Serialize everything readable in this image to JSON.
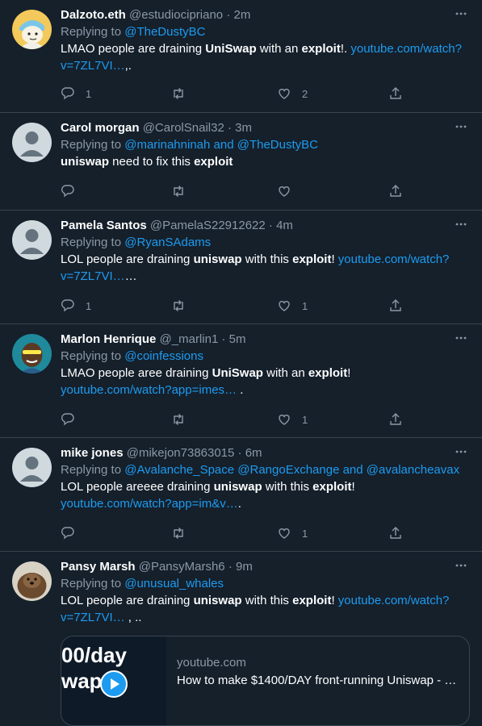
{
  "tweets": [
    {
      "name": "Dalzoto.eth",
      "handle": "@estudiocipriano",
      "time": "· 2m",
      "replying_prefix": "Replying to ",
      "replying_to": "@TheDustyBC",
      "replying_and": "",
      "replying_to_2": "",
      "body": {
        "p1": "LMAO people are draining ",
        "b1": "UniSwap",
        "p2": " with an ",
        "b2": "exploit",
        "p3": "!. ",
        "link": "youtube.com/watch?v=7ZL7VI…",
        "p4": ",."
      },
      "reply_count": "1",
      "retweet_count": "",
      "like_count": "2",
      "avatar": "cartoon-avatar"
    },
    {
      "name": "Carol morgan",
      "handle": "@CarolSnail32",
      "time": "· 3m",
      "replying_prefix": "Replying to ",
      "replying_to": "@marinahninah",
      "replying_and": " and ",
      "replying_to_2": "@TheDustyBC",
      "body": {
        "b1": "uniswap",
        "p2": " need to fix this ",
        "b2": "exploit"
      },
      "reply_count": "",
      "retweet_count": "",
      "like_count": "",
      "avatar": "default-avatar"
    },
    {
      "name": "Pamela Santos",
      "handle": "@PamelaS22912622",
      "time": "· 4m",
      "replying_prefix": "Replying to ",
      "replying_to": "@RyanSAdams",
      "body": {
        "p1": "LOL people are draining ",
        "b1": "uniswap",
        "p2": " with this ",
        "b2": "exploit",
        "p3": "! ",
        "link": "youtube.com/watch?v=7ZL7VI…",
        "p4": "…"
      },
      "reply_count": "1",
      "retweet_count": "",
      "like_count": "1",
      "avatar": "default-avatar"
    },
    {
      "name": "Marlon Henrique",
      "handle": "@_marlin1",
      "time": "· 5m",
      "replying_prefix": "Replying to ",
      "replying_to": "@coinfessions",
      "body": {
        "p1": "LMAO people aree draining ",
        "b1": "UniSwap",
        "p2": " with an ",
        "b2": "exploit",
        "p3": "!",
        "link": "youtube.com/watch?app=imes…",
        "p4": " ."
      },
      "reply_count": "",
      "retweet_count": "",
      "like_count": "1",
      "avatar": "sunglasses-avatar"
    },
    {
      "name": "mike jones",
      "handle": "@mikejon73863015",
      "time": "· 6m",
      "replying_prefix": "Replying to ",
      "replying_to": "@Avalanche_Space @RangoExchange",
      "replying_and": " and ",
      "replying_to_2": "@avalancheavax",
      "body": {
        "p1": "LOL people areeee draining ",
        "b1": "uniswap",
        "p2": " with this ",
        "b2": "exploit",
        "p3": "!",
        "link": "youtube.com/watch?app=im&v…",
        "p4": "."
      },
      "reply_count": "",
      "retweet_count": "",
      "like_count": "1",
      "avatar": "default-avatar"
    },
    {
      "name": "Pansy Marsh",
      "handle": "@PansyMarsh6",
      "time": "· 9m",
      "replying_prefix": "Replying to ",
      "replying_to": "@unusual_whales",
      "body": {
        "p1": "LOL people are draining ",
        "b1": "uniswap",
        "p2": " with this ",
        "b2": "exploit",
        "p3": "! ",
        "link": "youtube.com/watch?v=7ZL7VI…",
        "p4": " , .."
      },
      "card": {
        "source": "youtube.com",
        "title": "How to make $1400/DAY front-running Uniswap - …",
        "thumb_text_1": "00/day",
        "thumb_text_2": "wap"
      },
      "avatar": "otter-avatar"
    }
  ]
}
